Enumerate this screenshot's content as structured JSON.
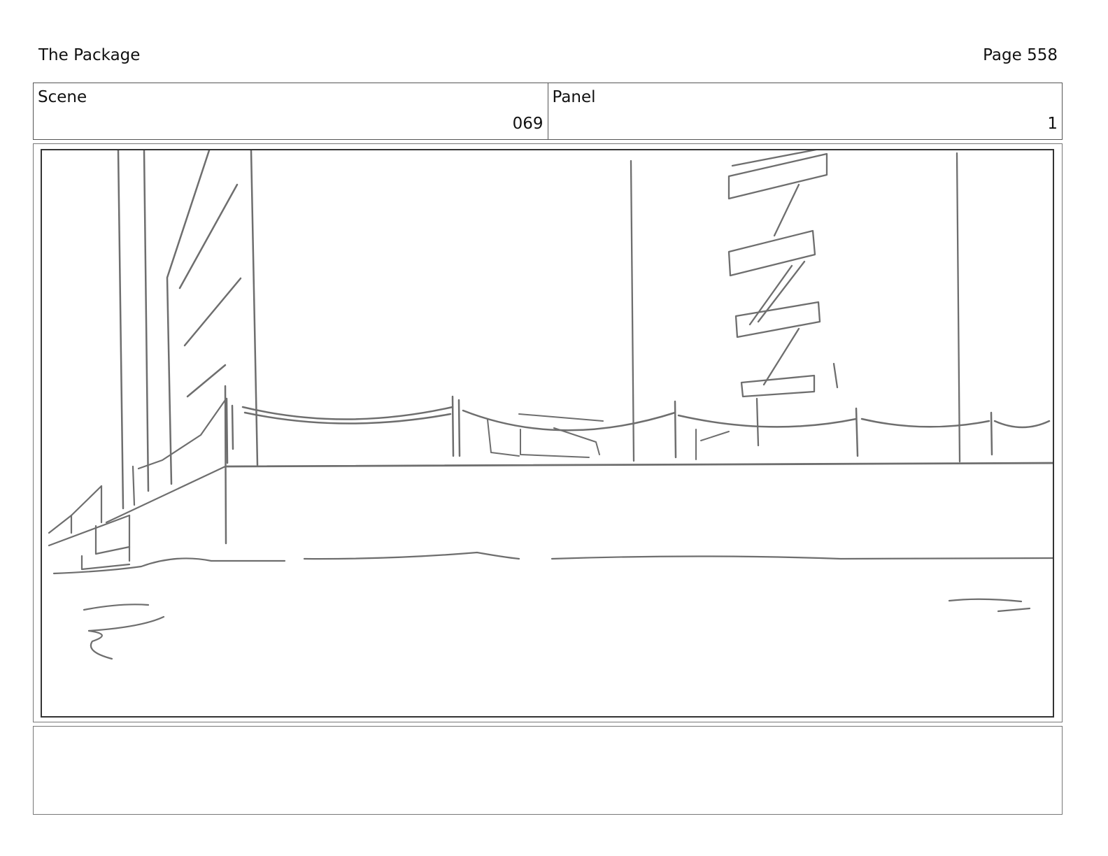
{
  "header": {
    "title": "The Package",
    "page": "Page 558"
  },
  "info": {
    "scene_label": "Scene",
    "scene_value": "069",
    "panel_label": "Panel",
    "panel_value": "1"
  },
  "panel": {
    "sketch": "storyboard-sketch",
    "stroke_color": "#6e6e6e"
  },
  "notes": {
    "text": ""
  }
}
